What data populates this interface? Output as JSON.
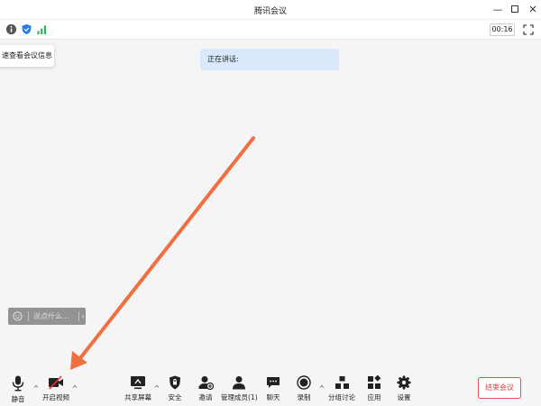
{
  "window": {
    "title": "腾讯会议",
    "minimize_glyph": "—",
    "close_glyph": "✕"
  },
  "infobar": {
    "timer": "00:16",
    "icons": [
      "info-icon",
      "shield-icon",
      "signal-icon",
      "fullscreen-icon"
    ]
  },
  "tooltip": {
    "text": "速查看会议信息"
  },
  "speaking": {
    "text": "正在讲话:"
  },
  "chat": {
    "placeholder": "说点什么...",
    "collapse": "‹"
  },
  "toolbar": {
    "mute": "静音",
    "video": "开启视频",
    "share": "共享屏幕",
    "security": "安全",
    "invite": "邀请",
    "members": "管理成员(1)",
    "chat": "聊天",
    "record": "录制",
    "breakout": "分组讨论",
    "apps": "应用",
    "settings": "设置",
    "caret": "^",
    "end": "结束会议"
  },
  "colors": {
    "accent_arrow": "#ef6f3f",
    "end_red": "#e04040",
    "speaking_bg": "#d9e9fb",
    "signal_green": "#2fb35a",
    "shield_blue": "#2b7de9"
  }
}
